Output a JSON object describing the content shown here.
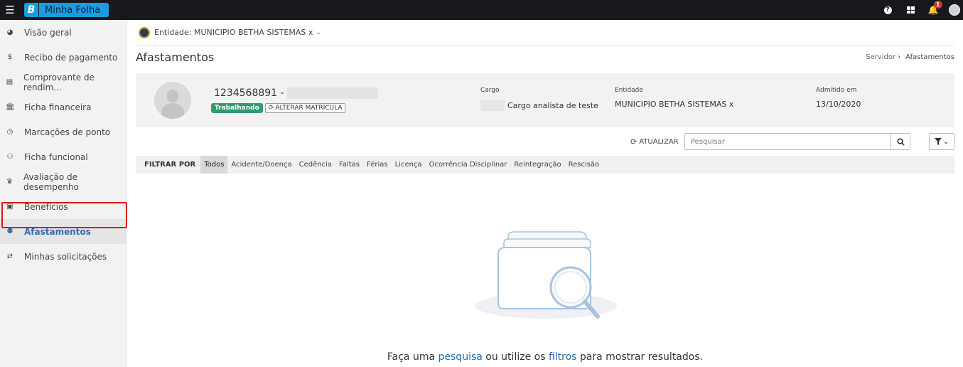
{
  "app": {
    "brand_letter": "B",
    "brand_name": "Minha Folha",
    "notifications_count": "1"
  },
  "sidebar": {
    "items": [
      {
        "label": "Visão geral",
        "icon": "pie-chart-icon",
        "glyph": "◕"
      },
      {
        "label": "Recibo de pagamento",
        "icon": "dollar-icon",
        "glyph": "$"
      },
      {
        "label": "Comprovante de rendim...",
        "icon": "document-icon",
        "glyph": "▤"
      },
      {
        "label": "Ficha financeira",
        "icon": "bank-icon",
        "glyph": "🏛"
      },
      {
        "label": "Marcações de ponto",
        "icon": "clock-icon",
        "glyph": "◷"
      },
      {
        "label": "Ficha funcional",
        "icon": "user-icon",
        "glyph": "⚇"
      },
      {
        "label": "Avaliação de desempenho",
        "icon": "trophy-icon",
        "glyph": "♛"
      },
      {
        "label": "Benefícios",
        "icon": "gift-icon",
        "glyph": "▣"
      },
      {
        "label": "Afastamentos",
        "icon": "user-times-icon",
        "glyph": "⚉"
      },
      {
        "label": "Minhas solicitações",
        "icon": "exchange-icon",
        "glyph": "⇄"
      }
    ],
    "active_index": 8
  },
  "entity": {
    "label": "Entidade: MUNICIPIO BETHA SISTEMAS x"
  },
  "page": {
    "title": "Afastamentos",
    "breadcrumb_parent": "Servidor",
    "breadcrumb_current": "Afastamentos"
  },
  "servant": {
    "id": "1234568891 -",
    "status": "Trabalhando",
    "change_button": "ALTERAR MATRÍCULA",
    "cargo_label": "Cargo",
    "cargo_value": "Cargo analista de teste",
    "entidade_label": "Entidade",
    "entidade_value": "MUNICIPIO BETHA SISTEMAS x",
    "admitido_label": "Admitido em",
    "admitido_value": "13/10/2020"
  },
  "actions": {
    "refresh_label": "ATUALIZAR",
    "search_placeholder": "Pesquisar"
  },
  "filters": {
    "label": "FILTRAR POR",
    "tabs": [
      "Todos",
      "Acidente/Doença",
      "Cedência",
      "Faltas",
      "Férias",
      "Licença",
      "Ocorrência Disciplinar",
      "Reintegração",
      "Rescisão"
    ],
    "active_index": 0
  },
  "empty_state": {
    "text_1": "Faça uma",
    "link_1": "pesquisa",
    "text_2": "ou utilize os",
    "link_2": "filtros",
    "text_3": "para mostrar resultados."
  },
  "colors": {
    "topbar": "#17181c",
    "brand": "#1a9de0",
    "active_link": "#2a6db0",
    "status_green": "#2f9c6e",
    "highlight_red": "#e0141e"
  }
}
